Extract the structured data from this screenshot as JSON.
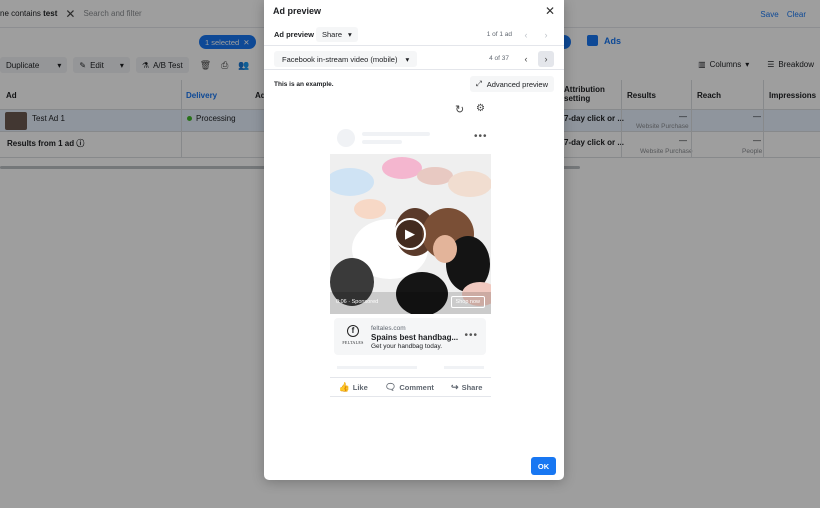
{
  "background": {
    "filter_prefix": "ne contains ",
    "filter_value": "test",
    "search_placeholder": "Search and filter",
    "save_label": "Save",
    "clear_label": "Clear",
    "selected_label": "1 selected",
    "ads_tab_label": "Ads",
    "toolbar": {
      "duplicate": "Duplicate",
      "edit": "Edit",
      "ab_test": "A/B Test",
      "columns": "Columns",
      "breakdown": "Breakdow"
    },
    "columns": {
      "ad": "Ad",
      "delivery": "Delivery",
      "ad_short": "Ad",
      "attribution": "Attribution setting",
      "results": "Results",
      "reach": "Reach",
      "impressions": "Impressions"
    },
    "row1": {
      "name": "Test Ad 1",
      "delivery": "Processing",
      "attribution": "7-day click or ...",
      "results": "—",
      "results_sub": "Website Purchase",
      "reach": "—"
    },
    "row2": {
      "name": "Results from 1 ad",
      "attribution": "7-day click or ...",
      "results": "—",
      "results_sub": "Website Purchase",
      "reach": "—",
      "reach_sub": "People"
    },
    "accent": "#1877f2"
  },
  "modal": {
    "title": "Ad preview",
    "header_label": "Ad preview",
    "share_label": "Share",
    "ad_count": "1 of 1 ad",
    "placement": "Facebook in-stream video (mobile)",
    "placement_count": "4 of 37",
    "example_note": "This is an example.",
    "advanced_preview": "Advanced preview",
    "preview": {
      "timestamp": "0:06 · Sponsored",
      "cta": "Shop now",
      "domain": "feltales.com",
      "headline": "Spains best handbag...",
      "description": "Get your handbag today.",
      "logo_text": "FELTALES",
      "actions": {
        "like": "Like",
        "comment": "Comment",
        "share": "Share"
      }
    },
    "ok_label": "OK"
  }
}
